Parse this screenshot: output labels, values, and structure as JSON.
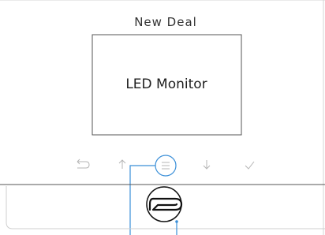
{
  "device": {
    "brand": "New Deal",
    "screen_label": "LED Monitor"
  },
  "buttons": [
    {
      "name": "back-button",
      "icon": "back-arrow-icon"
    },
    {
      "name": "up-button",
      "icon": "up-arrow-icon"
    },
    {
      "name": "menu-button",
      "icon": "menu-icon",
      "highlighted": true
    },
    {
      "name": "down-button",
      "icon": "down-arrow-icon"
    },
    {
      "name": "confirm-button",
      "icon": "checkmark-icon"
    }
  ],
  "colors": {
    "outline": "#c9c9c9",
    "callout": "#3a8fd8",
    "text": "#1e1e1e"
  },
  "logo": {
    "name": "nd-logo"
  }
}
